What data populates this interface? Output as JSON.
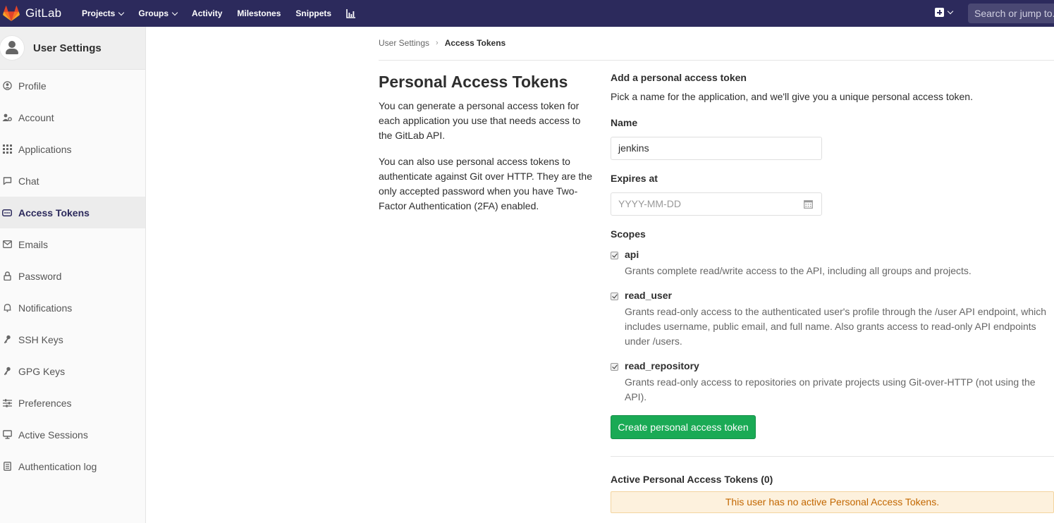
{
  "topnav": {
    "brand": "GitLab",
    "links": [
      {
        "label": "Projects",
        "dropdown": true
      },
      {
        "label": "Groups",
        "dropdown": true
      },
      {
        "label": "Activity",
        "dropdown": false
      },
      {
        "label": "Milestones",
        "dropdown": false
      },
      {
        "label": "Snippets",
        "dropdown": false
      }
    ],
    "search_placeholder": "Search or jump to..."
  },
  "sidebar": {
    "title": "User Settings",
    "items": [
      {
        "label": "Profile",
        "icon": "profile-icon",
        "active": false
      },
      {
        "label": "Account",
        "icon": "account-icon",
        "active": false
      },
      {
        "label": "Applications",
        "icon": "applications-icon",
        "active": false
      },
      {
        "label": "Chat",
        "icon": "chat-icon",
        "active": false
      },
      {
        "label": "Access Tokens",
        "icon": "token-icon",
        "active": true
      },
      {
        "label": "Emails",
        "icon": "email-icon",
        "active": false
      },
      {
        "label": "Password",
        "icon": "lock-icon",
        "active": false
      },
      {
        "label": "Notifications",
        "icon": "bell-icon",
        "active": false
      },
      {
        "label": "SSH Keys",
        "icon": "key-icon",
        "active": false
      },
      {
        "label": "GPG Keys",
        "icon": "key-icon",
        "active": false
      },
      {
        "label": "Preferences",
        "icon": "preferences-icon",
        "active": false
      },
      {
        "label": "Active Sessions",
        "icon": "monitor-icon",
        "active": false
      },
      {
        "label": "Authentication log",
        "icon": "log-icon",
        "active": false
      }
    ]
  },
  "breadcrumb": {
    "parent": "User Settings",
    "current": "Access Tokens"
  },
  "intro": {
    "title": "Personal Access Tokens",
    "p1": "You can generate a personal access token for each application you use that needs access to the GitLab API.",
    "p2": "You can also use personal access tokens to authenticate against Git over HTTP. They are the only accepted password when you have Two-Factor Authentication (2FA) enabled."
  },
  "form": {
    "heading": "Add a personal access token",
    "subheading": "Pick a name for the application, and we'll give you a unique personal access token.",
    "name_label": "Name",
    "name_value": "jenkins",
    "expires_label": "Expires at",
    "expires_placeholder": "YYYY-MM-DD",
    "scopes_label": "Scopes",
    "scopes": [
      {
        "name": "api",
        "checked": true,
        "description": "Grants complete read/write access to the API, including all groups and projects."
      },
      {
        "name": "read_user",
        "checked": true,
        "description": "Grants read-only access to the authenticated user's profile through the /user API endpoint, which includes username, public email, and full name. Also grants access to read-only API endpoints under /users."
      },
      {
        "name": "read_repository",
        "checked": true,
        "description": "Grants read-only access to repositories on private projects using Git-over-HTTP (not using the API)."
      }
    ],
    "create_button": "Create personal access token"
  },
  "active_tokens": {
    "title": "Active Personal Access Tokens (0)",
    "empty_message": "This user has no active Personal Access Tokens."
  },
  "colors": {
    "nav_bg": "#2c2a5c",
    "button_green": "#1aaa55",
    "warning_bg": "#fdf1dd",
    "warning_text": "#c26700"
  }
}
